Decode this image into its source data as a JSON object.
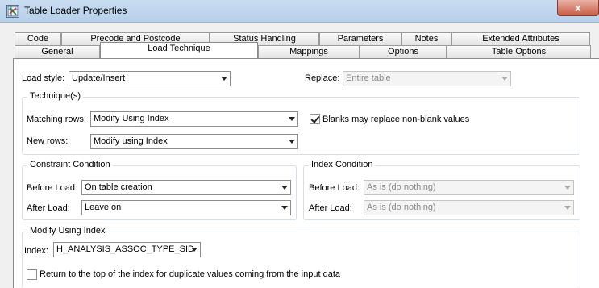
{
  "window": {
    "title": "Table Loader Properties",
    "close_glyph": "x"
  },
  "tabs": {
    "row1": [
      "Code",
      "Precode and Postcode",
      "Status Handling",
      "Parameters",
      "Notes",
      "Extended Attributes"
    ],
    "row2": [
      "General",
      "Load Technique",
      "Mappings",
      "Options",
      "Table Options"
    ],
    "active": "Load Technique"
  },
  "load": {
    "style_label": "Load style:",
    "style_value": "Update/Insert",
    "replace_label": "Replace:",
    "replace_value": "Entire table"
  },
  "techniques": {
    "title": "Technique(s)",
    "matching_label": "Matching rows:",
    "matching_value": "Modify Using Index",
    "new_label": "New rows:",
    "new_value": "Modify using Index",
    "blanks_label": "Blanks may replace non-blank values",
    "blanks_checked": true
  },
  "constraint": {
    "title": "Constraint Condition",
    "before_label": "Before Load:",
    "before_value": "On table creation",
    "after_label": "After Load:",
    "after_value": "Leave on"
  },
  "index_condition": {
    "title": "Index Condition",
    "before_label": "Before Load:",
    "before_value": "As is (do nothing)",
    "after_label": "After Load:",
    "after_value": "As is (do nothing)"
  },
  "modify_index": {
    "title": "Modify Using Index",
    "index_label": "Index:",
    "index_value": "H_ANALYSIS_ASSOC_TYPE_SID",
    "return_label": "Return to the top of the index for duplicate values coming from the input data",
    "return_checked": false
  }
}
